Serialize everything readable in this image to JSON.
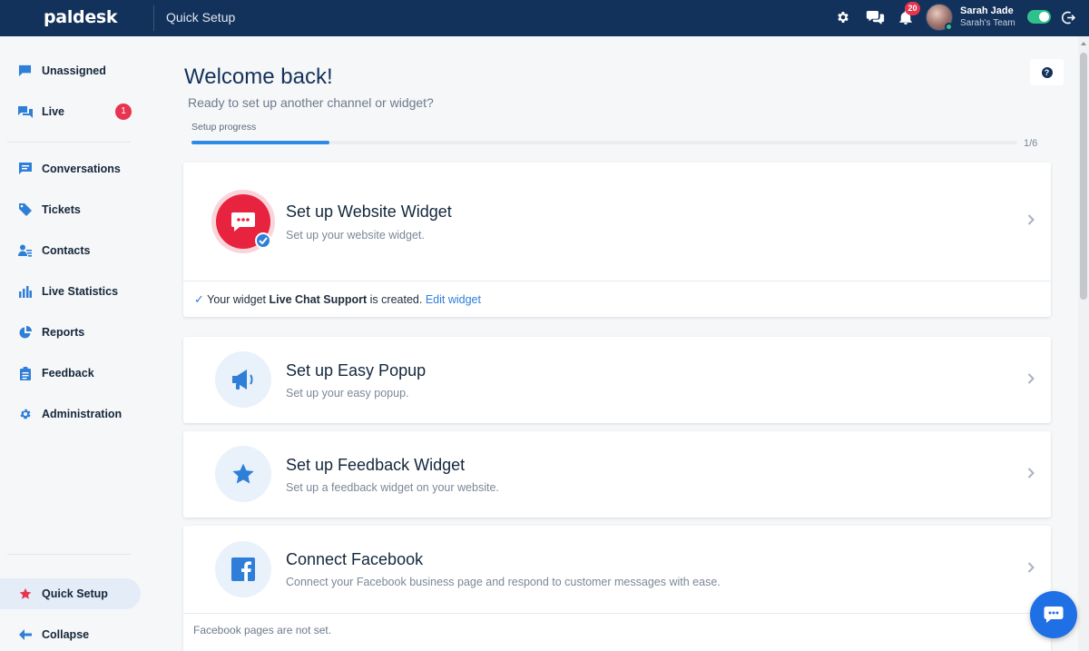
{
  "app": {
    "logo": "paldesk",
    "title": "Quick Setup"
  },
  "header": {
    "notifications_count": "20",
    "user": {
      "name": "Sarah Jade",
      "team": "Sarah's Team"
    }
  },
  "sidebar": {
    "items": [
      {
        "label": "Unassigned",
        "icon": "flag-chat-icon"
      },
      {
        "label": "Live",
        "icon": "chat-bubbles-icon",
        "badge": "1"
      },
      {
        "label": "Conversations",
        "icon": "chat-bubble-icon"
      },
      {
        "label": "Tickets",
        "icon": "tag-icon"
      },
      {
        "label": "Contacts",
        "icon": "contacts-icon"
      },
      {
        "label": "Live Statistics",
        "icon": "bar-chart-icon"
      },
      {
        "label": "Reports",
        "icon": "pie-chart-icon"
      },
      {
        "label": "Feedback",
        "icon": "clipboard-icon"
      },
      {
        "label": "Administration",
        "icon": "gear-icon"
      }
    ],
    "quick_setup": "Quick Setup",
    "collapse": "Collapse"
  },
  "main": {
    "welcome": "Welcome back!",
    "subtitle": "Ready to set up another channel or widget?",
    "progress": {
      "label": "Setup progress",
      "count": "1/6",
      "completed": 1,
      "total": 6
    },
    "cards": [
      {
        "title": "Set up Website Widget",
        "desc": "Set up your website widget.",
        "footer": {
          "prefix": "Your widget",
          "widget_name": "Live Chat Support",
          "suffix": "is created.",
          "link": "Edit widget"
        }
      },
      {
        "title": "Set up Easy Popup",
        "desc": "Set up your easy popup."
      },
      {
        "title": "Set up Feedback Widget",
        "desc": "Set up a feedback widget on your website."
      },
      {
        "title": "Connect Facebook",
        "desc": "Connect your Facebook business page and respond to customer messages with ease.",
        "footer": {
          "text": "Facebook pages are not set."
        }
      }
    ]
  },
  "colors": {
    "topbar": "#13325b",
    "accent": "#2f8ae6",
    "badge": "#e8344e",
    "widget_red": "#e8233f",
    "toggle": "#2fc18c"
  }
}
